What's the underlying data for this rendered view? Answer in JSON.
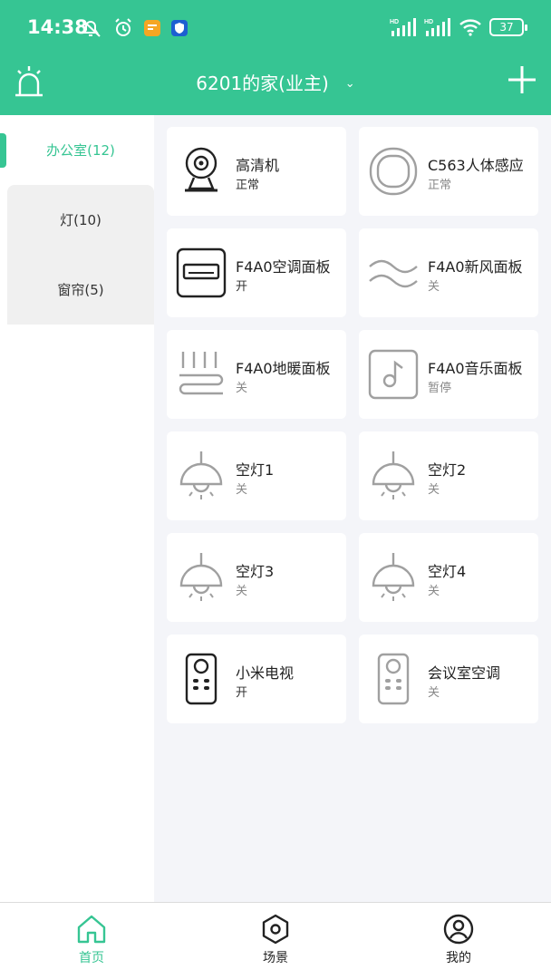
{
  "status_bar": {
    "time": "14:38",
    "battery": "37",
    "signal_labels": [
      "HD",
      "HD"
    ]
  },
  "header": {
    "home_title": "6201的家(业主)"
  },
  "sidebar": {
    "items": [
      {
        "label": "办公室(12)",
        "active": true
      },
      {
        "label": "灯(10)",
        "active": false
      },
      {
        "label": "窗帘(5)",
        "active": false
      }
    ]
  },
  "devices": [
    {
      "name": "高清机",
      "state": "正常",
      "icon": "camera-icon"
    },
    {
      "name": "C563人体感应",
      "state": "正常",
      "icon": "motion-sensor-icon"
    },
    {
      "name": "F4A0空调面板",
      "state": "开",
      "icon": "air-conditioner-icon"
    },
    {
      "name": "F4A0新风面板",
      "state": "关",
      "icon": "fresh-air-icon"
    },
    {
      "name": "F4A0地暖面板",
      "state": "关",
      "icon": "floor-heating-icon"
    },
    {
      "name": "F4A0音乐面板",
      "state": "暂停",
      "icon": "music-icon"
    },
    {
      "name": "空灯1",
      "state": "关",
      "icon": "pendant-lamp-icon"
    },
    {
      "name": "空灯2",
      "state": "关",
      "icon": "pendant-lamp-icon"
    },
    {
      "name": "空灯3",
      "state": "关",
      "icon": "pendant-lamp-icon"
    },
    {
      "name": "空灯4",
      "state": "关",
      "icon": "pendant-lamp-icon"
    },
    {
      "name": "小米电视",
      "state": "开",
      "icon": "remote-icon"
    },
    {
      "name": "会议室空调",
      "state": "关",
      "icon": "remote-icon"
    }
  ],
  "bottom_nav": {
    "items": [
      {
        "label": "首页",
        "icon": "home-icon",
        "active": true
      },
      {
        "label": "场景",
        "icon": "hexagon-scene-icon",
        "active": false
      },
      {
        "label": "我的",
        "icon": "profile-icon",
        "active": false
      }
    ]
  },
  "colors": {
    "accent": "#36c593",
    "background": "#f4f5f9",
    "card": "#ffffff",
    "icon_on": "#222222",
    "icon_off": "#a0a0a0"
  }
}
